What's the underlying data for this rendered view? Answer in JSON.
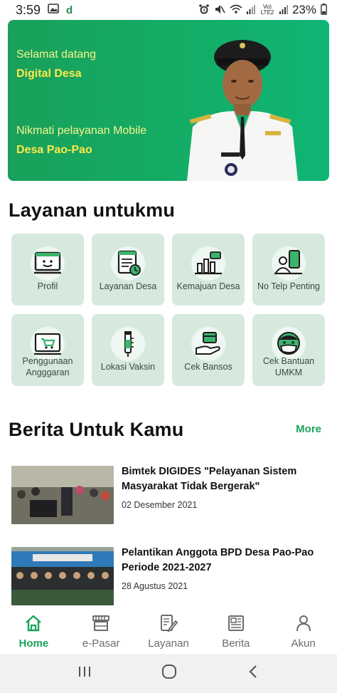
{
  "status_bar": {
    "time": "3:59",
    "network_label": "Vo) LTE2",
    "battery": "23%",
    "icons": [
      "image-icon",
      "d-app-icon",
      "alarm-icon",
      "mute-icon",
      "wifi-icon",
      "signal-icon",
      "battery-icon"
    ]
  },
  "banner": {
    "line1": "Selamat datang",
    "line2": "Digital Desa",
    "line3": "Nikmati pelayanan Mobile",
    "line4": "Desa Pao-Pao",
    "background": "#13ad66",
    "text_color": "#f4f48a"
  },
  "services": {
    "title": "Layanan untukmu",
    "items": [
      {
        "label": "Profil",
        "icon": "profile-monitor-icon"
      },
      {
        "label": "Layanan Desa",
        "icon": "document-clock-icon"
      },
      {
        "label": "Kemajuan Desa",
        "icon": "bar-chart-icon"
      },
      {
        "label": "No Telp Penting",
        "icon": "phone-contact-icon"
      },
      {
        "label": "Penggunaan Angggaran",
        "icon": "cart-monitor-icon"
      },
      {
        "label": "Lokasi Vaksin",
        "icon": "vaccine-icon"
      },
      {
        "label": "Cek Bansos",
        "icon": "hand-card-icon"
      },
      {
        "label": "Cek Bantuan UMKM",
        "icon": "masked-person-icon"
      }
    ],
    "tile_color": "#d5eadd"
  },
  "news": {
    "title": "Berita Untuk Kamu",
    "more_label": "More",
    "items": [
      {
        "title": "Bimtek DIGIDES \"Pelayanan Sistem Masyarakat Tidak Bergerak\"",
        "date": "02 Desember 2021"
      },
      {
        "title": "Pelantikan Anggota BPD Desa Pao-Pao Periode 2021-2027",
        "date": "28 Agustus 2021"
      }
    ]
  },
  "bottom_nav": {
    "items": [
      {
        "label": "Home",
        "icon": "home-icon",
        "active": true
      },
      {
        "label": "e-Pasar",
        "icon": "store-icon",
        "active": false
      },
      {
        "label": "Layanan",
        "icon": "edit-document-icon",
        "active": false
      },
      {
        "label": "Berita",
        "icon": "newspaper-icon",
        "active": false
      },
      {
        "label": "Akun",
        "icon": "person-icon",
        "active": false
      }
    ],
    "active_color": "#1aa35a"
  },
  "system_nav": {
    "icons": [
      "recent-apps-icon",
      "home-circle-icon",
      "back-icon"
    ]
  }
}
